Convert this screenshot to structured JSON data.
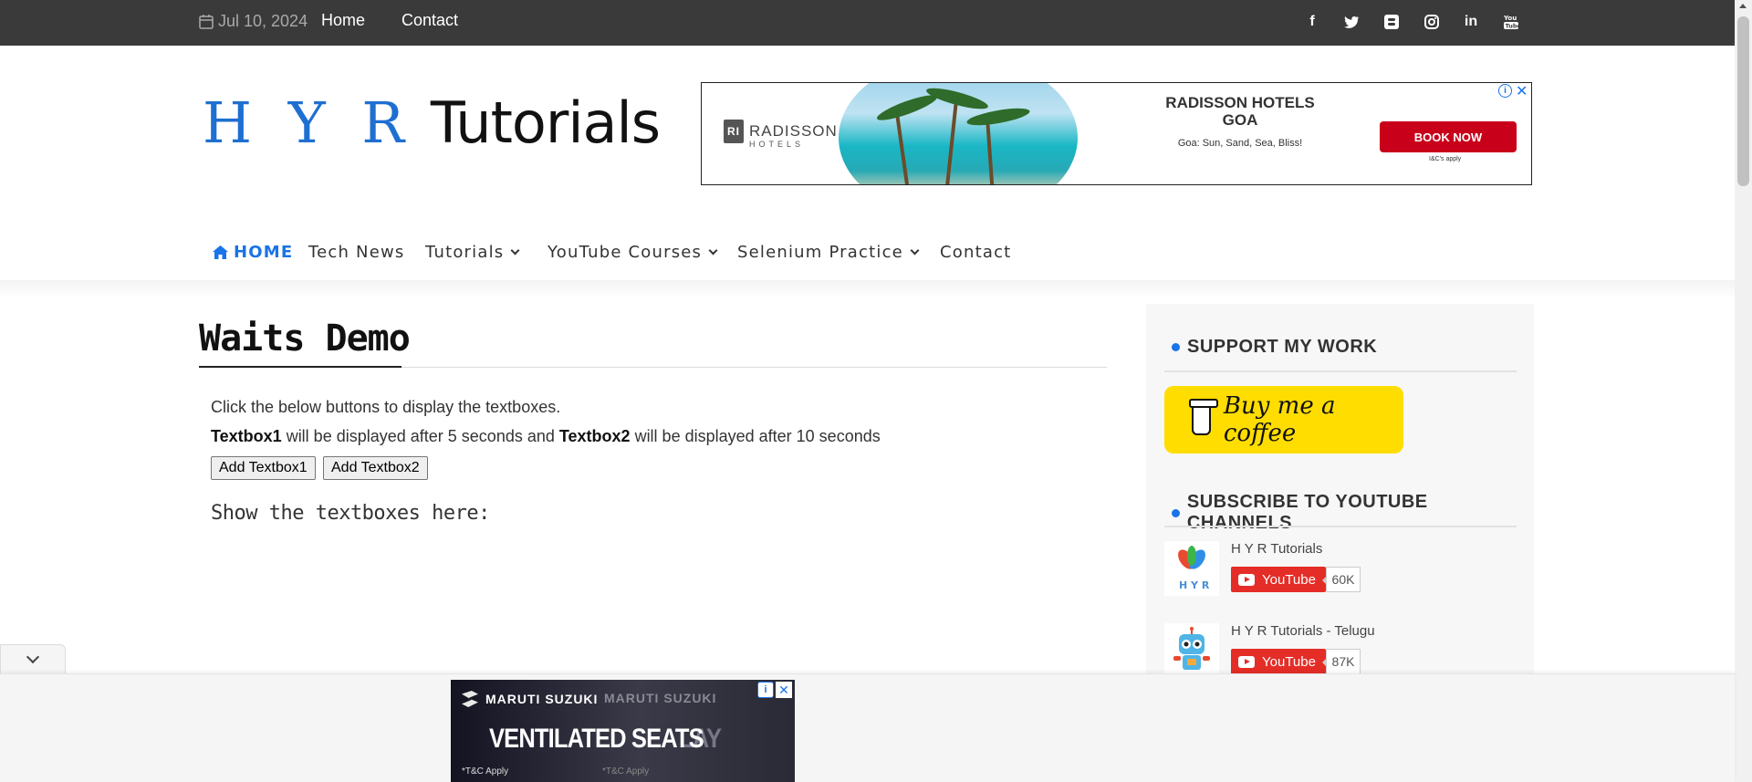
{
  "topbar": {
    "date": "Jul 10, 2024",
    "links": [
      "Home",
      "Contact"
    ],
    "social_icons": [
      "facebook-icon",
      "twitter-icon",
      "blogger-icon",
      "instagram-icon",
      "linkedin-icon",
      "youtube-icon"
    ]
  },
  "logo": {
    "part1": "H Y R",
    "part2": "Tutorials"
  },
  "top_ad": {
    "brand": "RADISSON",
    "brand_sub": "HOTELS",
    "headline_line1": "RADISSON HOTELS",
    "headline_line2": "GOA",
    "tagline": "Goa: Sun, Sand, Sea, Bliss!",
    "cta": "BOOK NOW",
    "fine_print": "I&C's apply"
  },
  "nav": {
    "home": "HOME",
    "items": [
      "Tech News",
      "Tutorials",
      "YouTube Courses",
      "Selenium Practice",
      "Contact"
    ]
  },
  "main": {
    "title": "Waits Demo",
    "para1": "Click the below buttons to display the textboxes.",
    "para2_b1": "Textbox1",
    "para2_mid": " will be displayed after 5 seconds and ",
    "para2_b2": "Textbox2",
    "para2_end": " will be displayed after 10 seconds",
    "button1": "Add Textbox1",
    "button2": "Add Textbox2",
    "show_label": "Show the textboxes here:"
  },
  "sidebar": {
    "support_heading": "SUPPORT MY WORK",
    "bmc_label": "Buy me a coffee",
    "subscribe_heading": "SUBSCRIBE TO YOUTUBE CHANNELS",
    "channels": [
      {
        "name": "H Y R Tutorials",
        "button": "YouTube",
        "count": "60K"
      },
      {
        "name": "H Y R Tutorials - Telugu",
        "button": "YouTube",
        "count": "87K"
      }
    ]
  },
  "bottom_ad": {
    "brand": "MARUTI SUZUKI",
    "brand_ghost": "MARUTI SUZUKI",
    "headline": "VENTILATED SEATS",
    "headline_ghost": "LAY",
    "tc": "*T&C Apply",
    "tc_ghost": "*T&C Apply"
  },
  "colors": {
    "topbar_bg": "#3a3a3a",
    "accent_blue": "#1a73e8",
    "bmc_yellow": "#ffdd00",
    "youtube_red": "#e52d27",
    "ad_cta_red": "#c9001a"
  }
}
